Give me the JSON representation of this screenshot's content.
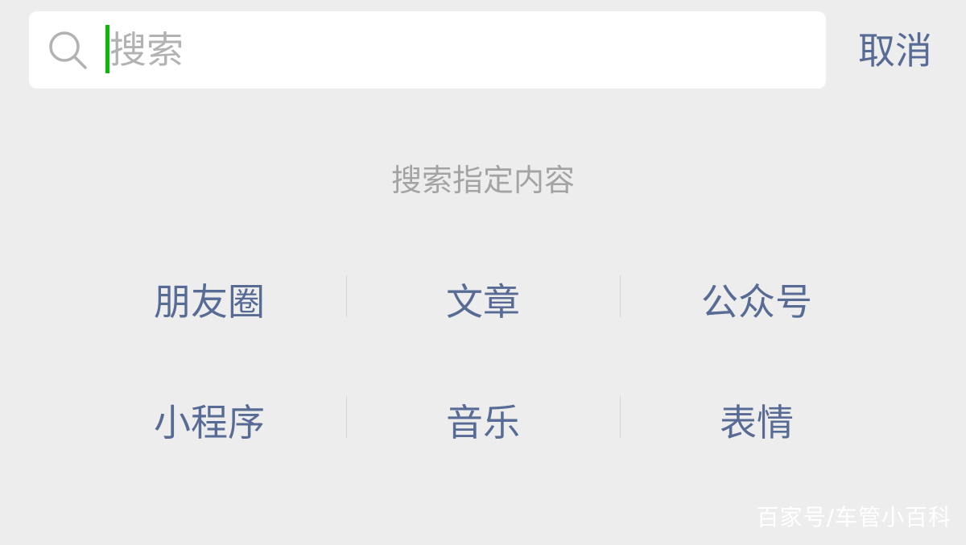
{
  "search": {
    "value": "",
    "placeholder": "搜索",
    "icon": "search-icon"
  },
  "cancel_label": "取消",
  "section_heading": "搜索指定内容",
  "categories": [
    {
      "label": "朋友圈"
    },
    {
      "label": "文章"
    },
    {
      "label": "公众号"
    },
    {
      "label": "小程序"
    },
    {
      "label": "音乐"
    },
    {
      "label": "表情"
    }
  ],
  "watermark": "百家号/车管小百科",
  "colors": {
    "background": "#ededed",
    "link": "#576b95",
    "caret": "#09bb07",
    "placeholder": "#b2b2b2",
    "hint": "#a3a3a3"
  }
}
